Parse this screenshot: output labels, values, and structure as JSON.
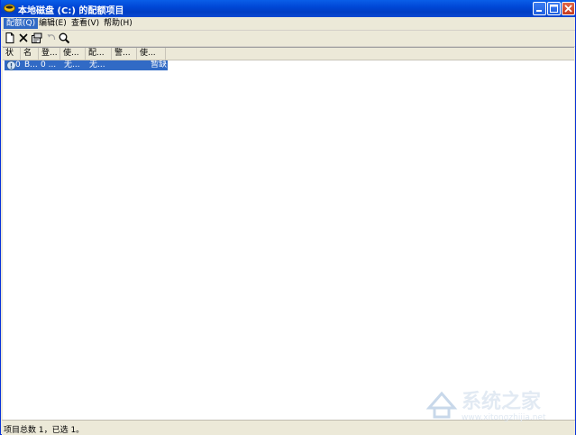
{
  "window": {
    "title": "本地磁盘 (C:) 的配额项目",
    "controls": {
      "minimize_icon": "minimize-icon",
      "maximize_icon": "maximize-icon",
      "close_icon": "close-icon"
    }
  },
  "menubar": {
    "items": [
      {
        "label": "配额(Q)"
      },
      {
        "label": "编辑(E)"
      },
      {
        "label": "查看(V)"
      },
      {
        "label": "帮助(H)"
      }
    ]
  },
  "toolbar": {
    "icons": [
      "new-quota-entry-icon",
      "delete-icon",
      "properties-icon",
      "undo-icon",
      "find-icon"
    ]
  },
  "list": {
    "columns": [
      "状",
      "名",
      "登...",
      "使...",
      "配...",
      "警...",
      "使..."
    ],
    "rows": [
      {
        "status": "0",
        "name": "B...",
        "login": "0 ...",
        "used": "无...",
        "limit": "无...",
        "warning": "",
        "used_pct": "暂缺"
      }
    ]
  },
  "statusbar": {
    "text": "项目总数 1，已选 1。"
  },
  "watermark": {
    "text": "系统之家",
    "url_text": "www.xitongzhijia.net"
  },
  "colors": {
    "titlebar": "#0047d6",
    "selection": "#316ac5",
    "chrome": "#ece9d8"
  }
}
